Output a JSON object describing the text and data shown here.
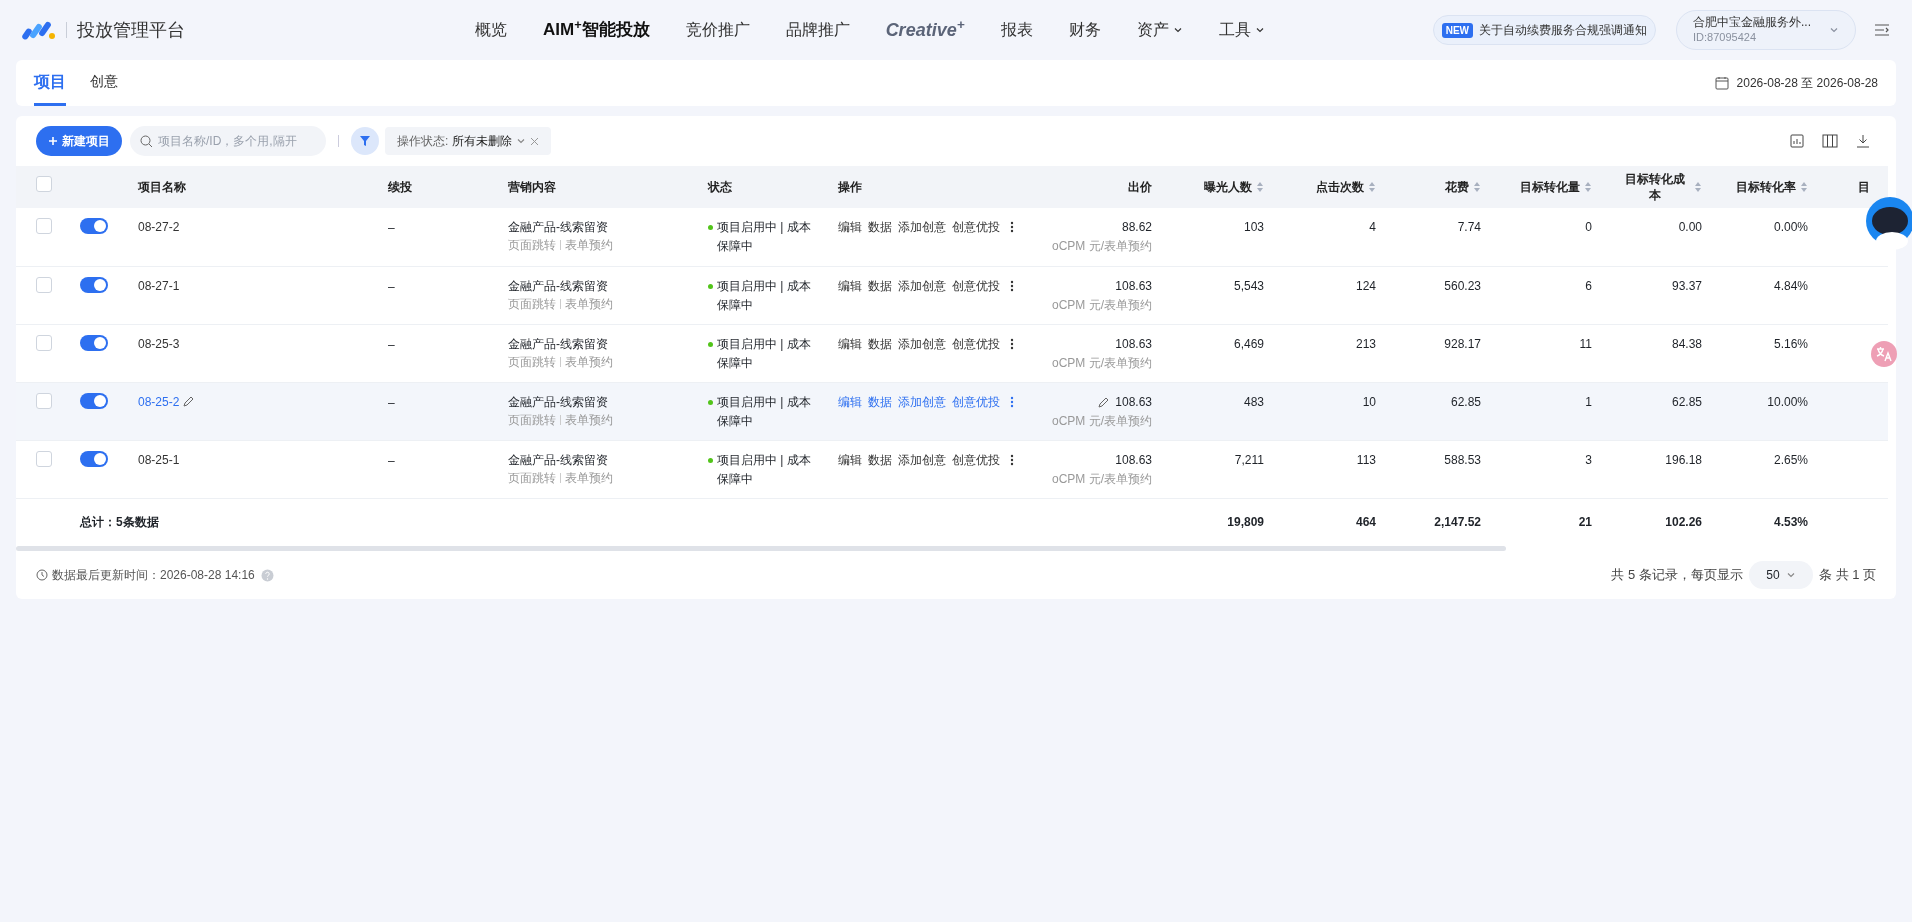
{
  "header": {
    "title": "投放管理平台",
    "nav": [
      {
        "label": "概览",
        "kind": "text"
      },
      {
        "label": "AIM$^{+}$智能投放",
        "kind": "strong"
      },
      {
        "label": "竞价推广",
        "kind": "text"
      },
      {
        "label": "品牌推广",
        "kind": "text"
      },
      {
        "label": "Creative$^{+}$",
        "kind": "brand"
      },
      {
        "label": "报表",
        "kind": "text"
      },
      {
        "label": "财务",
        "kind": "text"
      },
      {
        "label": "资产",
        "kind": "dropdown"
      },
      {
        "label": "工具",
        "kind": "dropdown"
      }
    ],
    "notice": {
      "badge": "NEW",
      "text": "关于自动续费服务合规强调通知"
    },
    "account": {
      "name": "合肥中宝金融服务外...",
      "id": "ID:87095424"
    }
  },
  "tabs": [
    {
      "label": "项目",
      "selected": true
    },
    {
      "label": "创意",
      "selected": false
    }
  ],
  "date_range": "2026-08-28 至 2026-08-28",
  "toolbar": {
    "new_button": "新建项目",
    "search": {
      "placeholder": "项目名称/ID，多个用,隔开"
    },
    "filter": {
      "label": "操作状态:",
      "value": "所有未删除"
    }
  },
  "table": {
    "select_all_checked": false,
    "columns": [
      {
        "label": "项目名称",
        "sortable": false
      },
      {
        "label": "续投",
        "sortable": false
      },
      {
        "label": "营销内容",
        "sortable": false
      },
      {
        "label": "状态",
        "sortable": false
      },
      {
        "label": "操作",
        "sortable": false
      },
      {
        "label": "出价",
        "sortable": false
      },
      {
        "label": "曝光人数",
        "sortable": true
      },
      {
        "label": "点击次数",
        "sortable": true
      },
      {
        "label": "花费",
        "sortable": true
      },
      {
        "label": "目标转化量",
        "sortable": true
      },
      {
        "label": "目标转化成本",
        "sortable": true
      },
      {
        "label": "目标转化率",
        "sortable": true
      },
      {
        "label": "目",
        "sortable": false
      }
    ],
    "rows": [
      {
        "checked": false,
        "on": true,
        "hovered": false,
        "name": "08-27-2",
        "renew": "–",
        "content": "金融产品-线索留资",
        "tags": [
          "页面跳转",
          "表单预约"
        ],
        "status": "项目启用中 | 成本保障中",
        "actions": [
          "编辑",
          "数据",
          "添加创意",
          "创意优投"
        ],
        "bid": "88.62",
        "bid_unit": "oCPM 元/表单预约",
        "values": [
          "103",
          "4",
          "7.74",
          "0",
          "0.00",
          "0.00%"
        ]
      },
      {
        "checked": false,
        "on": true,
        "hovered": false,
        "name": "08-27-1",
        "renew": "–",
        "content": "金融产品-线索留资",
        "tags": [
          "页面跳转",
          "表单预约"
        ],
        "status": "项目启用中 | 成本保障中",
        "actions": [
          "编辑",
          "数据",
          "添加创意",
          "创意优投"
        ],
        "bid": "108.63",
        "bid_unit": "oCPM 元/表单预约",
        "values": [
          "5,543",
          "124",
          "560.23",
          "6",
          "93.37",
          "4.84%"
        ]
      },
      {
        "checked": false,
        "on": true,
        "hovered": false,
        "name": "08-25-3",
        "renew": "–",
        "content": "金融产品-线索留资",
        "tags": [
          "页面跳转",
          "表单预约"
        ],
        "status": "项目启用中 | 成本保障中",
        "actions": [
          "编辑",
          "数据",
          "添加创意",
          "创意优投"
        ],
        "bid": "108.63",
        "bid_unit": "oCPM 元/表单预约",
        "values": [
          "6,469",
          "213",
          "928.17",
          "11",
          "84.38",
          "5.16%"
        ]
      },
      {
        "checked": false,
        "on": true,
        "hovered": true,
        "name": "08-25-2",
        "renew": "–",
        "content": "金融产品-线索留资",
        "tags": [
          "页面跳转",
          "表单预约"
        ],
        "status": "项目启用中 | 成本保障中",
        "actions": [
          "编辑",
          "数据",
          "添加创意",
          "创意优投"
        ],
        "bid": "108.63",
        "bid_unit": "oCPM 元/表单预约",
        "values": [
          "483",
          "10",
          "62.85",
          "1",
          "62.85",
          "10.00%"
        ]
      },
      {
        "checked": false,
        "on": true,
        "hovered": false,
        "name": "08-25-1",
        "renew": "–",
        "content": "金融产品-线索留资",
        "tags": [
          "页面跳转",
          "表单预约"
        ],
        "status": "项目启用中 | 成本保障中",
        "actions": [
          "编辑",
          "数据",
          "添加创意",
          "创意优投"
        ],
        "bid": "108.63",
        "bid_unit": "oCPM 元/表单预约",
        "values": [
          "7,211",
          "113",
          "588.53",
          "3",
          "196.18",
          "2.65%"
        ]
      }
    ],
    "total": {
      "label": "总计：5条数据",
      "values": [
        "19,809",
        "464",
        "2,147.52",
        "21",
        "102.26",
        "4.53%"
      ]
    }
  },
  "footer": {
    "updated": "数据最后更新时间：2026-08-28 14:16",
    "records": "共 5 条记录，每页显示",
    "page_size": "50",
    "pages": "条 共 1 页"
  }
}
